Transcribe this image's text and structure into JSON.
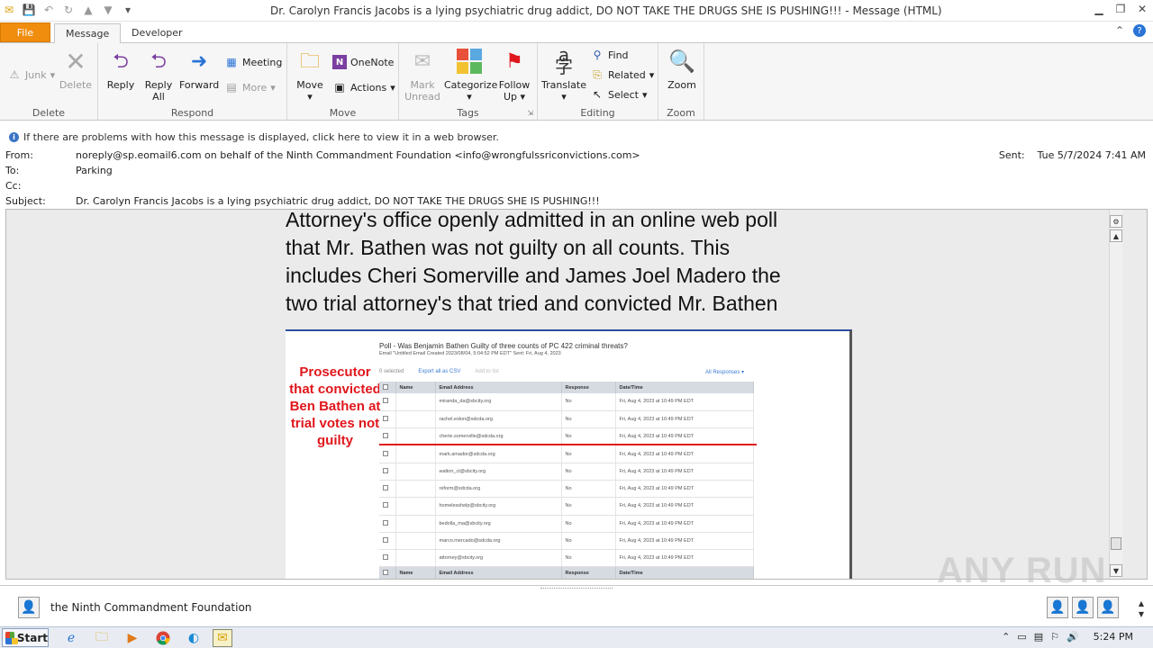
{
  "window": {
    "title": "Dr. Carolyn Francis Jacobs is a lying psychiatric drug addict, DO NOT TAKE THE DRUGS SHE IS PUSHING!!! - Message (HTML)"
  },
  "ribbon_tabs": {
    "file": "File",
    "message": "Message",
    "developer": "Developer"
  },
  "ribbon": {
    "delete_group": {
      "junk": "Junk",
      "delete": "Delete",
      "label": "Delete"
    },
    "respond_group": {
      "reply": "Reply",
      "reply_all_1": "Reply",
      "reply_all_2": "All",
      "forward": "Forward",
      "meeting": "Meeting",
      "more": "More",
      "label": "Respond"
    },
    "move_group": {
      "move": "Move",
      "onenote": "OneNote",
      "actions": "Actions",
      "label": "Move"
    },
    "tags_group": {
      "mark_unread_1": "Mark",
      "mark_unread_2": "Unread",
      "categorize": "Categorize",
      "follow_up_1": "Follow",
      "follow_up_2": "Up",
      "label": "Tags"
    },
    "editing_group": {
      "translate": "Translate",
      "find": "Find",
      "related": "Related",
      "select": "Select",
      "label": "Editing"
    },
    "zoom_group": {
      "zoom": "Zoom",
      "label": "Zoom"
    }
  },
  "infobar": {
    "text": "If there are problems with how this message is displayed, click here to view it in a web browser."
  },
  "header": {
    "from_label": "From:",
    "from_value": "noreply@sp.eomail6.com on behalf of the Ninth Commandment Foundation <info@wrongfulssriconvictions.com>",
    "to_label": "To:",
    "to_value": "Parking",
    "cc_label": "Cc:",
    "cc_value": "",
    "subject_label": "Subject:",
    "subject_value": "Dr. Carolyn Francis Jacobs is a lying psychiatric drug addict, DO NOT TAKE THE DRUGS SHE IS PUSHING!!!",
    "sent_label": "Sent:",
    "sent_value": "Tue 5/7/2024 7:41 AM"
  },
  "body": {
    "lines": [
      "Attorney's office openly admitted in an online web poll",
      "that Mr. Bathen was not guilty on all counts. This",
      "includes Cheri Somerville and James Joel Madero the",
      "two trial attorney's that tried and convicted Mr. Bathen"
    ]
  },
  "poll": {
    "title": "Poll - Was Benjamin Bathen Guilty of three counts of PC 422 criminal threats?",
    "subtitle": "Email \"Untitled Email Created 2023/08/04, 5:04:52 PM EDT\" Sent: Fri, Aug 4, 2023",
    "tools": {
      "selected": "0 selected",
      "export": "Export all as CSV",
      "add": "Add to list",
      "responses": "All Responses ▾"
    },
    "annotation": [
      "Prosecutor",
      "that convicted",
      "Ben Bathen at",
      "trial votes not",
      "guilty"
    ],
    "columns": [
      "Name",
      "Email Address",
      "Response",
      "Date/Time"
    ],
    "rows": [
      {
        "name": "",
        "email": "miranda_da@sbcity.org",
        "response": "No",
        "date": "Fri, Aug 4, 2023 at 10:49 PM EDT"
      },
      {
        "name": "",
        "email": "rachel.eslon@sdcda.org",
        "response": "No",
        "date": "Fri, Aug 4, 2023 at 10:49 PM EDT"
      },
      {
        "name": "",
        "email": "cherie.somerville@sdcda.org",
        "response": "No",
        "date": "Fri, Aug 4, 2023 at 10:49 PM EDT"
      },
      {
        "name": "",
        "email": "mark.amador@sdcda.org",
        "response": "No",
        "date": "Fri, Aug 4, 2023 at 10:49 PM EDT"
      },
      {
        "name": "",
        "email": "walton_cl@sbcity.org",
        "response": "No",
        "date": "Fri, Aug 4, 2023 at 10:49 PM EDT"
      },
      {
        "name": "",
        "email": "reform@sdcda.org",
        "response": "No",
        "date": "Fri, Aug 4, 2023 at 10:49 PM EDT"
      },
      {
        "name": "",
        "email": "homelesshelp@sbcity.org",
        "response": "No",
        "date": "Fri, Aug 4, 2023 at 10:49 PM EDT"
      },
      {
        "name": "",
        "email": "bedolla_ma@sbcity.org",
        "response": "No",
        "date": "Fri, Aug 4, 2023 at 10:49 PM EDT"
      },
      {
        "name": "",
        "email": "marco.mercado@sdcda.org",
        "response": "No",
        "date": "Fri, Aug 4, 2023 at 10:49 PM EDT"
      },
      {
        "name": "",
        "email": "attorney@sbcity.org",
        "response": "No",
        "date": "Fri, Aug 4, 2023 at 10:49 PM EDT"
      }
    ]
  },
  "people_pane": {
    "name": "the Ninth Commandment Foundation"
  },
  "taskbar": {
    "start": "Start",
    "time": "5:24 PM"
  },
  "watermark": "ANY RUN",
  "colors": {
    "file_tab": "#f08d0e",
    "accent_red": "#e0171c",
    "poll_header": "#d6dbe2"
  }
}
